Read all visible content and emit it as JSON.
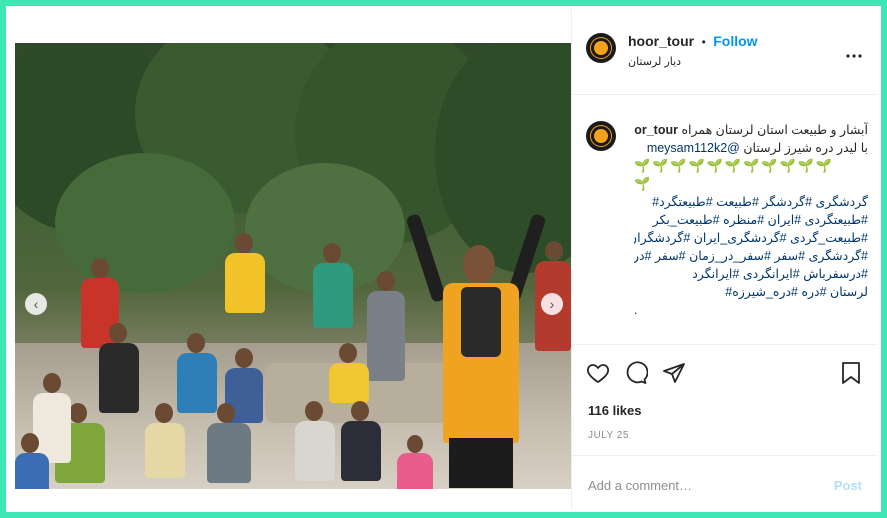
{
  "post": {
    "username": "hoor_tour",
    "follow_separator": "•",
    "follow_label": "Follow",
    "location": "دیار لرستان",
    "more_icon": "more-horizontal-icon",
    "caption": {
      "username": "hoor_tour",
      "line1": "آبشار و طبیعت استان لرستان همراه",
      "mention": "@meysam112k2",
      "line2_rest": "با لیدر دره شیرز لرستان",
      "sprouts_line1": "🌱🌱🌱🌱🌱🌱🌱🌱🌱🌱🌱",
      "sprouts_line2": "🌱",
      "tags": [
        "گردشگری #گردشگر #طبیعت #طبیعتگرد#",
        "#طبیعتگردی #ایران #منظره #طبیعت_بکر",
        "#طبیعت_گردی #گردشگری_ایران #گردشگران",
        "#گردشگری #سفر #سفر_در_زمان #سفر #درسفر",
        "#درسفرباش #ایرانگردی #ایرانگرد",
        "لرستان #دره #دره_شیرزه#"
      ],
      "last": "."
    },
    "likes": "116 likes",
    "date": "JULY 25",
    "comment_placeholder": "Add a comment…",
    "post_label": "Post"
  },
  "photo": {
    "nav_prev": "‹",
    "nav_next": "›",
    "dots": 4,
    "active_dot": 0
  },
  "colors": {
    "frame": "#3ee8b5",
    "follow": "#0095f6",
    "post_disabled": "#b2dffc",
    "muted": "#8e8e8e"
  }
}
